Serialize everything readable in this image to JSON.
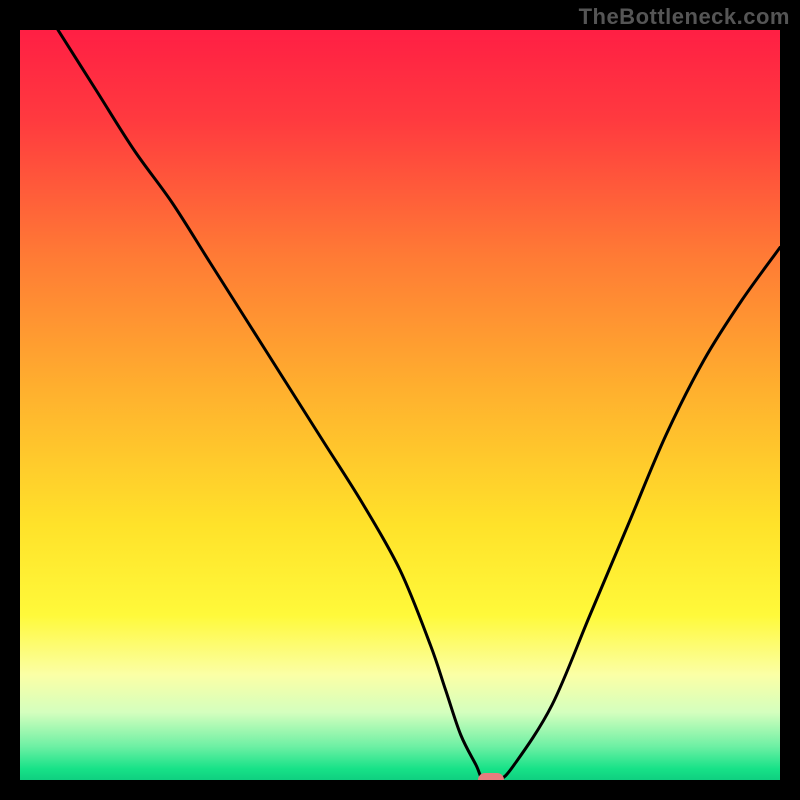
{
  "attribution": "TheBottleneck.com",
  "colors": {
    "frame": "#000000",
    "marker": "#e77c7e",
    "curve": "#000000",
    "gradient_stops": [
      {
        "offset": 0.0,
        "color": "#ff1f44"
      },
      {
        "offset": 0.12,
        "color": "#ff3a3f"
      },
      {
        "offset": 0.3,
        "color": "#ff7a35"
      },
      {
        "offset": 0.48,
        "color": "#ffb02e"
      },
      {
        "offset": 0.66,
        "color": "#ffe22a"
      },
      {
        "offset": 0.78,
        "color": "#fff93a"
      },
      {
        "offset": 0.86,
        "color": "#fbffa6"
      },
      {
        "offset": 0.91,
        "color": "#d4ffbe"
      },
      {
        "offset": 0.955,
        "color": "#6ef0a4"
      },
      {
        "offset": 0.985,
        "color": "#17e288"
      },
      {
        "offset": 1.0,
        "color": "#0fcf80"
      }
    ]
  },
  "chart_data": {
    "type": "line",
    "title": "",
    "xlabel": "",
    "ylabel": "",
    "xlim": [
      0,
      100
    ],
    "ylim": [
      0,
      100
    ],
    "grid": false,
    "legend": false,
    "series": [
      {
        "name": "bottleneck-curve",
        "x": [
          5,
          10,
          15,
          20,
          25,
          30,
          35,
          40,
          45,
          50,
          54,
          56,
          58,
          60,
          61,
          63,
          65,
          70,
          75,
          80,
          85,
          90,
          95,
          100
        ],
        "y": [
          100,
          92,
          84,
          77,
          69,
          61,
          53,
          45,
          37,
          28,
          18,
          12,
          6,
          2,
          0,
          0,
          2,
          10,
          22,
          34,
          46,
          56,
          64,
          71
        ]
      }
    ],
    "marker": {
      "x": 62,
      "y": 0
    }
  }
}
